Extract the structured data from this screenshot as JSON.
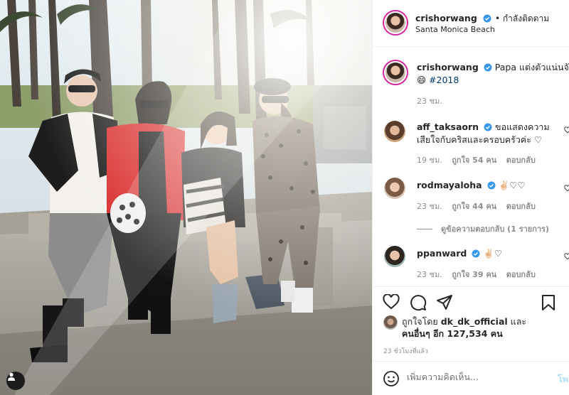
{
  "post": {
    "author": "crishorwang",
    "follow_status": "• กำลังติดตาม",
    "location": "Santa Monica Beach"
  },
  "caption": {
    "username": "crishorwang",
    "line1": "Papa แต่งตัวแน่นจัง 😄",
    "line2_emoji": "😄",
    "hashtag": "#2018",
    "time": "23 ชม."
  },
  "comments": [
    {
      "username": "aff_taksaorn",
      "text_line1": "ขอแสดงความ",
      "text_line2": "เสียใจกับคริสและครอบครัวค่ะ ♡",
      "time": "19 ชม.",
      "likes": "ถูกใจ 54 คน",
      "reply": "ตอบกลับ"
    },
    {
      "username": "rodmayaloha",
      "text_line1": "✌🏻♡♡",
      "time": "23 ชม.",
      "likes": "ถูกใจ 44 คน",
      "reply": "ตอบกลับ",
      "view_replies": "ดูข้อความตอบกลับ (1 รายการ)"
    },
    {
      "username": "ppanward",
      "text_line1": "✌🏻♡",
      "time": "23 ชม.",
      "likes": "ถูกใจ 39 คน",
      "reply": "ตอบกลับ"
    }
  ],
  "likes_block": {
    "line1_prefix": "ถูกใจโดย",
    "liker": "dk_dk_official",
    "line1_suffix": "และ",
    "line2": "คนอื่นๆ อีก 127,534 คน"
  },
  "time_ago": "23 ชั่วโมงที่แล้ว",
  "composer": {
    "placeholder": "เพิ่มความคิดเห็น...",
    "post_label": "โพ"
  },
  "icons": [
    "verified-icon",
    "heart-icon",
    "comment-icon",
    "share-icon",
    "bookmark-icon",
    "emoji-icon",
    "user-tag-icon"
  ],
  "colors": {
    "verified": "#3897f0",
    "story_ring": "#d6249f",
    "hashtag": "#00376b",
    "post_button": "#b2dffc",
    "muted": "#8e8e8e"
  }
}
